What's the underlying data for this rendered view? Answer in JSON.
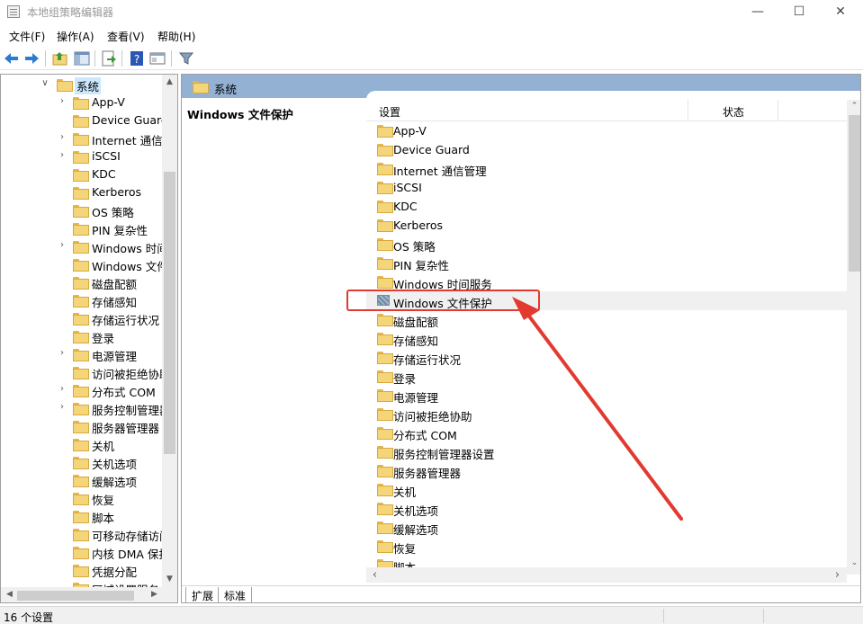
{
  "window": {
    "title": "本地组策略编辑器",
    "min_glyph": "—",
    "max_glyph": "☐",
    "close_glyph": "✕"
  },
  "menu": [
    "文件(F)",
    "操作(A)",
    "查看(V)",
    "帮助(H)"
  ],
  "toolbar": [
    "back-arrow-icon",
    "forward-arrow-icon",
    "up-folder-icon",
    "show-hide-tree-icon",
    "export-list-icon",
    "help-icon",
    "properties-icon",
    "filter-icon"
  ],
  "tree": {
    "root": {
      "label": "系统",
      "chevron": "∨"
    },
    "items": [
      {
        "label": "App-V",
        "expandable": true
      },
      {
        "label": "Device Guard",
        "expandable": false
      },
      {
        "label": "Internet 通信管",
        "expandable": true
      },
      {
        "label": "iSCSI",
        "expandable": true
      },
      {
        "label": "KDC",
        "expandable": false
      },
      {
        "label": "Kerberos",
        "expandable": false
      },
      {
        "label": "OS 策略",
        "expandable": false
      },
      {
        "label": "PIN 复杂性",
        "expandable": false
      },
      {
        "label": "Windows 时间",
        "expandable": true
      },
      {
        "label": "Windows 文件",
        "expandable": false
      },
      {
        "label": "磁盘配额",
        "expandable": false
      },
      {
        "label": "存储感知",
        "expandable": false
      },
      {
        "label": "存储运行状况",
        "expandable": false
      },
      {
        "label": "登录",
        "expandable": false
      },
      {
        "label": "电源管理",
        "expandable": true
      },
      {
        "label": "访问被拒绝协助",
        "expandable": false
      },
      {
        "label": "分布式 COM",
        "expandable": true
      },
      {
        "label": "服务控制管理器",
        "expandable": true
      },
      {
        "label": "服务器管理器",
        "expandable": false
      },
      {
        "label": "关机",
        "expandable": false
      },
      {
        "label": "关机选项",
        "expandable": false
      },
      {
        "label": "缓解选项",
        "expandable": false
      },
      {
        "label": "恢复",
        "expandable": false
      },
      {
        "label": "脚本",
        "expandable": false
      },
      {
        "label": "可移动存储访问",
        "expandable": false
      },
      {
        "label": "内核 DMA 保护",
        "expandable": false
      },
      {
        "label": "凭据分配",
        "expandable": false
      },
      {
        "label": "区域设置服务",
        "expandable": false
      }
    ]
  },
  "right": {
    "header": "系统",
    "description_title": "Windows 文件保护",
    "columns": {
      "setting": "设置",
      "state": "状态"
    },
    "items": [
      {
        "label": "App-V",
        "selected": false
      },
      {
        "label": "Device Guard",
        "selected": false
      },
      {
        "label": "Internet 通信管理",
        "selected": false
      },
      {
        "label": "iSCSI",
        "selected": false
      },
      {
        "label": "KDC",
        "selected": false
      },
      {
        "label": "Kerberos",
        "selected": false
      },
      {
        "label": "OS 策略",
        "selected": false
      },
      {
        "label": "PIN 复杂性",
        "selected": false
      },
      {
        "label": "Windows 时间服务",
        "selected": false
      },
      {
        "label": "Windows 文件保护",
        "selected": true
      },
      {
        "label": "磁盘配额",
        "selected": false
      },
      {
        "label": "存储感知",
        "selected": false
      },
      {
        "label": "存储运行状况",
        "selected": false
      },
      {
        "label": "登录",
        "selected": false
      },
      {
        "label": "电源管理",
        "selected": false
      },
      {
        "label": "访问被拒绝协助",
        "selected": false
      },
      {
        "label": "分布式 COM",
        "selected": false
      },
      {
        "label": "服务控制管理器设置",
        "selected": false
      },
      {
        "label": "服务器管理器",
        "selected": false
      },
      {
        "label": "关机",
        "selected": false
      },
      {
        "label": "关机选项",
        "selected": false
      },
      {
        "label": "缓解选项",
        "selected": false
      },
      {
        "label": "恢复",
        "selected": false
      },
      {
        "label": "脚本",
        "selected": false
      }
    ]
  },
  "tabs": [
    "扩展",
    "标准"
  ],
  "status": "16 个设置",
  "scroll": {
    "up": "▲",
    "down": "▼",
    "left": "◀",
    "right": "▶",
    "list_up": "⌃",
    "list_down": "⌄",
    "list_left": "‹",
    "list_right": "›"
  },
  "annotation_color": "#e23a2f"
}
